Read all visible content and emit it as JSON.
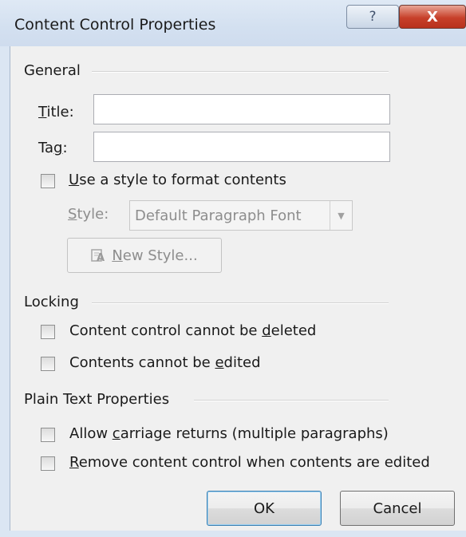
{
  "window": {
    "title": "Content Control Properties",
    "help_label": "?",
    "close_label": "X"
  },
  "general": {
    "heading": "General",
    "title_label_u": "T",
    "title_label_rest": "itle:",
    "title_value": "",
    "tag_label_pre": "Ta",
    "tag_label_u": "g",
    "tag_label_post": ":",
    "tag_value": "",
    "use_style": {
      "checked": false,
      "label_u": "U",
      "label_rest": "se a style to format contents"
    },
    "style_label_u": "S",
    "style_label_rest": "tyle:",
    "style_selected": "Default Paragraph Font",
    "new_style_pre": "",
    "new_style_u": "N",
    "new_style_rest": "ew Style...",
    "new_style_icon": "new-style-icon"
  },
  "locking": {
    "heading": "Locking",
    "items": [
      {
        "pre": "Content control cannot be ",
        "u": "d",
        "post": "eleted",
        "checked": false
      },
      {
        "pre": "Contents cannot be ",
        "u": "e",
        "post": "dited",
        "checked": false
      }
    ]
  },
  "plain_text": {
    "heading": "Plain Text Properties",
    "items": [
      {
        "pre": "Allow ",
        "u": "c",
        "post": "arriage returns (multiple paragraphs)",
        "checked": false
      },
      {
        "pre": "",
        "u": "R",
        "post": "emove content control when contents are edited",
        "checked": false
      }
    ]
  },
  "buttons": {
    "ok": "OK",
    "cancel": "Cancel"
  },
  "colors": {
    "frame": "#dbe6f3",
    "body": "#f0f0f0",
    "close": "#c7402a",
    "default_button_border": "#3c7fb1"
  }
}
